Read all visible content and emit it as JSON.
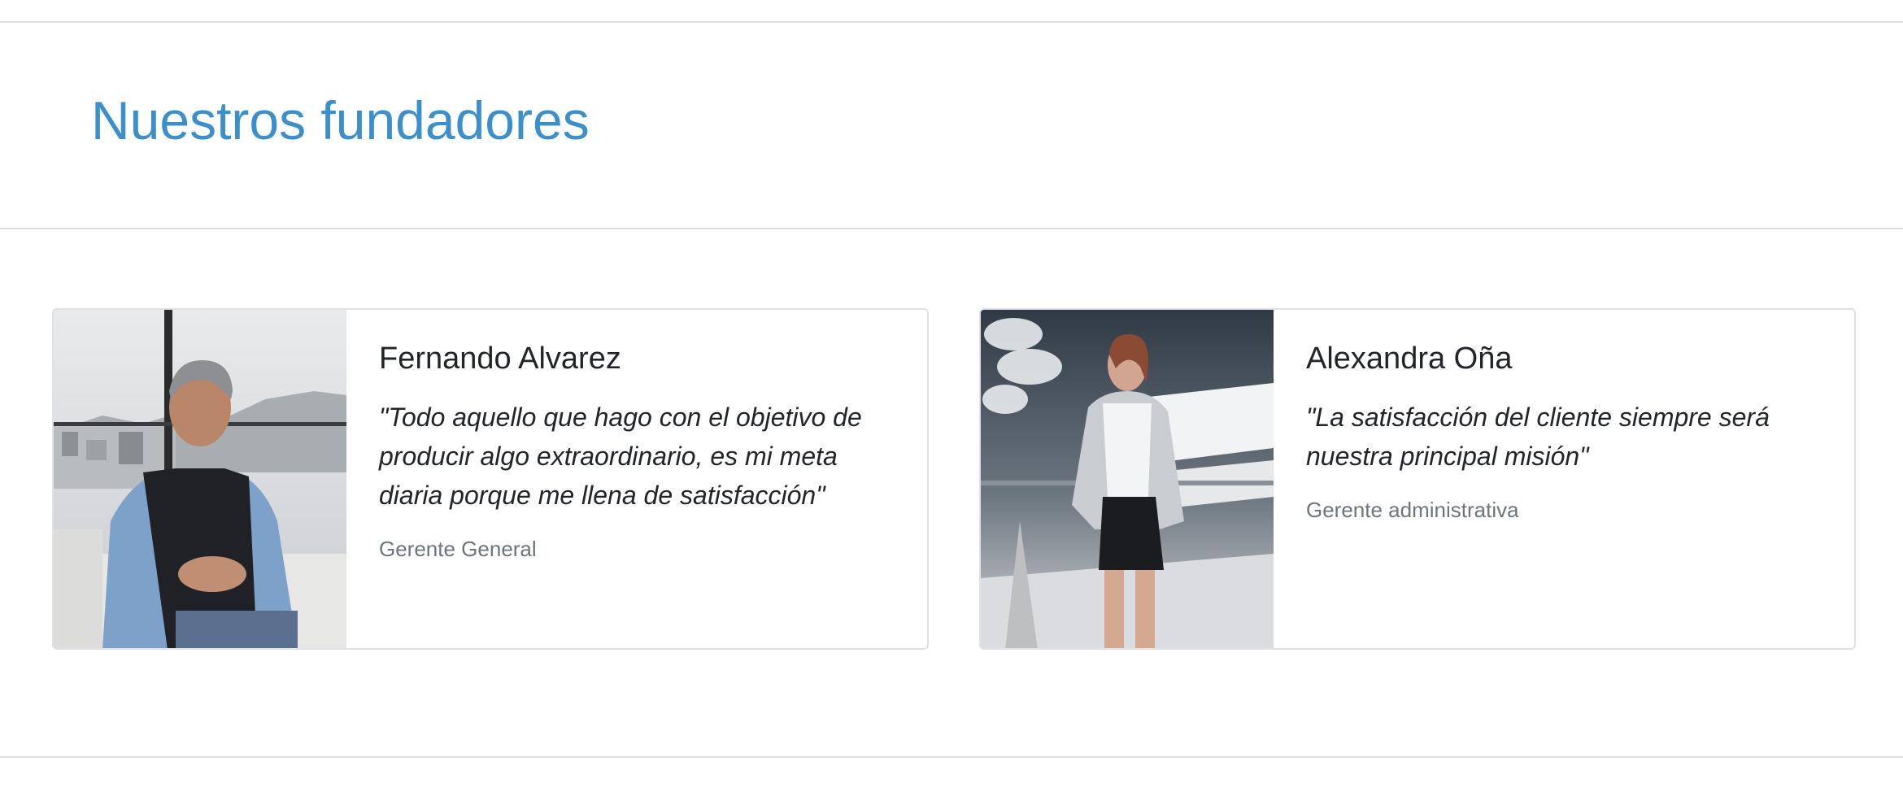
{
  "section": {
    "title": "Nuestros fundadores"
  },
  "founders": [
    {
      "name": "Fernando Alvarez",
      "quote": "\"Todo aquello que hago con el objetivo de producir algo extraordinario, es mi meta diaria porque me llena de satisfacción\"",
      "role": "Gerente General"
    },
    {
      "name": "Alexandra Oña",
      "quote": "\"La satisfacción del cliente siempre será nuestra principal misión\"",
      "role": "Gerente administrativa"
    }
  ],
  "colors": {
    "title": "#3b8fcb",
    "text": "#212529",
    "muted": "#6c757d",
    "border": "#dfe1e4"
  }
}
